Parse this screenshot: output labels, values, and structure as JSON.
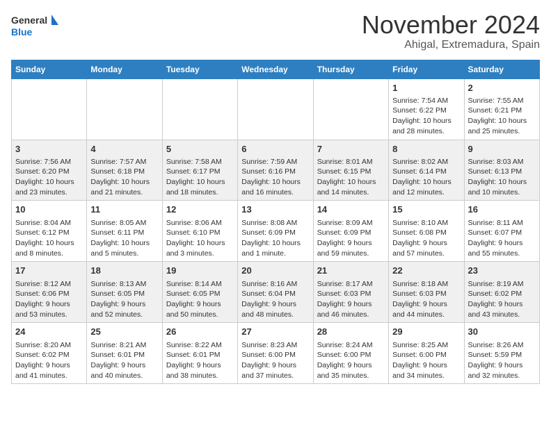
{
  "header": {
    "logo_general": "General",
    "logo_blue": "Blue",
    "month": "November 2024",
    "location": "Ahigal, Extremadura, Spain"
  },
  "weekdays": [
    "Sunday",
    "Monday",
    "Tuesday",
    "Wednesday",
    "Thursday",
    "Friday",
    "Saturday"
  ],
  "weeks": [
    [
      {
        "day": "",
        "info": ""
      },
      {
        "day": "",
        "info": ""
      },
      {
        "day": "",
        "info": ""
      },
      {
        "day": "",
        "info": ""
      },
      {
        "day": "",
        "info": ""
      },
      {
        "day": "1",
        "info": "Sunrise: 7:54 AM\nSunset: 6:22 PM\nDaylight: 10 hours and 28 minutes."
      },
      {
        "day": "2",
        "info": "Sunrise: 7:55 AM\nSunset: 6:21 PM\nDaylight: 10 hours and 25 minutes."
      }
    ],
    [
      {
        "day": "3",
        "info": "Sunrise: 7:56 AM\nSunset: 6:20 PM\nDaylight: 10 hours and 23 minutes."
      },
      {
        "day": "4",
        "info": "Sunrise: 7:57 AM\nSunset: 6:18 PM\nDaylight: 10 hours and 21 minutes."
      },
      {
        "day": "5",
        "info": "Sunrise: 7:58 AM\nSunset: 6:17 PM\nDaylight: 10 hours and 18 minutes."
      },
      {
        "day": "6",
        "info": "Sunrise: 7:59 AM\nSunset: 6:16 PM\nDaylight: 10 hours and 16 minutes."
      },
      {
        "day": "7",
        "info": "Sunrise: 8:01 AM\nSunset: 6:15 PM\nDaylight: 10 hours and 14 minutes."
      },
      {
        "day": "8",
        "info": "Sunrise: 8:02 AM\nSunset: 6:14 PM\nDaylight: 10 hours and 12 minutes."
      },
      {
        "day": "9",
        "info": "Sunrise: 8:03 AM\nSunset: 6:13 PM\nDaylight: 10 hours and 10 minutes."
      }
    ],
    [
      {
        "day": "10",
        "info": "Sunrise: 8:04 AM\nSunset: 6:12 PM\nDaylight: 10 hours and 8 minutes."
      },
      {
        "day": "11",
        "info": "Sunrise: 8:05 AM\nSunset: 6:11 PM\nDaylight: 10 hours and 5 minutes."
      },
      {
        "day": "12",
        "info": "Sunrise: 8:06 AM\nSunset: 6:10 PM\nDaylight: 10 hours and 3 minutes."
      },
      {
        "day": "13",
        "info": "Sunrise: 8:08 AM\nSunset: 6:09 PM\nDaylight: 10 hours and 1 minute."
      },
      {
        "day": "14",
        "info": "Sunrise: 8:09 AM\nSunset: 6:09 PM\nDaylight: 9 hours and 59 minutes."
      },
      {
        "day": "15",
        "info": "Sunrise: 8:10 AM\nSunset: 6:08 PM\nDaylight: 9 hours and 57 minutes."
      },
      {
        "day": "16",
        "info": "Sunrise: 8:11 AM\nSunset: 6:07 PM\nDaylight: 9 hours and 55 minutes."
      }
    ],
    [
      {
        "day": "17",
        "info": "Sunrise: 8:12 AM\nSunset: 6:06 PM\nDaylight: 9 hours and 53 minutes."
      },
      {
        "day": "18",
        "info": "Sunrise: 8:13 AM\nSunset: 6:05 PM\nDaylight: 9 hours and 52 minutes."
      },
      {
        "day": "19",
        "info": "Sunrise: 8:14 AM\nSunset: 6:05 PM\nDaylight: 9 hours and 50 minutes."
      },
      {
        "day": "20",
        "info": "Sunrise: 8:16 AM\nSunset: 6:04 PM\nDaylight: 9 hours and 48 minutes."
      },
      {
        "day": "21",
        "info": "Sunrise: 8:17 AM\nSunset: 6:03 PM\nDaylight: 9 hours and 46 minutes."
      },
      {
        "day": "22",
        "info": "Sunrise: 8:18 AM\nSunset: 6:03 PM\nDaylight: 9 hours and 44 minutes."
      },
      {
        "day": "23",
        "info": "Sunrise: 8:19 AM\nSunset: 6:02 PM\nDaylight: 9 hours and 43 minutes."
      }
    ],
    [
      {
        "day": "24",
        "info": "Sunrise: 8:20 AM\nSunset: 6:02 PM\nDaylight: 9 hours and 41 minutes."
      },
      {
        "day": "25",
        "info": "Sunrise: 8:21 AM\nSunset: 6:01 PM\nDaylight: 9 hours and 40 minutes."
      },
      {
        "day": "26",
        "info": "Sunrise: 8:22 AM\nSunset: 6:01 PM\nDaylight: 9 hours and 38 minutes."
      },
      {
        "day": "27",
        "info": "Sunrise: 8:23 AM\nSunset: 6:00 PM\nDaylight: 9 hours and 37 minutes."
      },
      {
        "day": "28",
        "info": "Sunrise: 8:24 AM\nSunset: 6:00 PM\nDaylight: 9 hours and 35 minutes."
      },
      {
        "day": "29",
        "info": "Sunrise: 8:25 AM\nSunset: 6:00 PM\nDaylight: 9 hours and 34 minutes."
      },
      {
        "day": "30",
        "info": "Sunrise: 8:26 AM\nSunset: 5:59 PM\nDaylight: 9 hours and 32 minutes."
      }
    ]
  ]
}
